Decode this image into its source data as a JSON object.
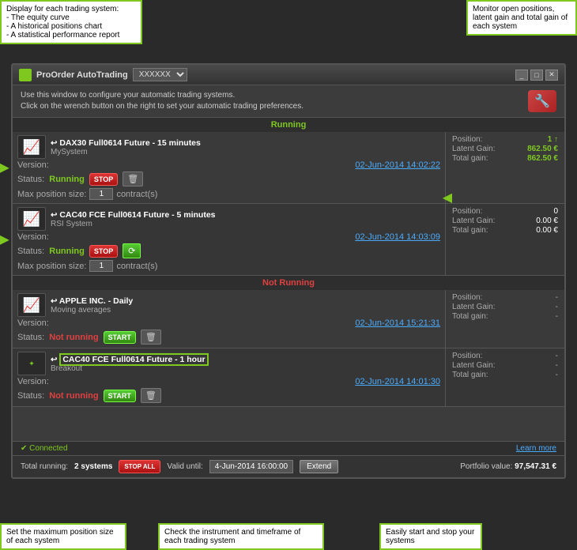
{
  "annotations": {
    "topleft": {
      "lines": [
        "Display for each trading system:",
        "- The equity curve",
        "- A historical positions chart",
        "- A statistical performance report"
      ]
    },
    "topright": {
      "text": "Monitor open positions, latent gain and total gain of each system"
    },
    "bottomleft": {
      "text": "Set the maximum position size of each system"
    },
    "bottomcenter": {
      "text": "Check the instrument and timeframe of each trading system"
    },
    "bottomright": {
      "text": "Easily start and stop your systems"
    }
  },
  "window": {
    "title": "ProOrder AutoTrading",
    "dropdown_value": "XXXXXX",
    "header_line1": "Use this window to configure your automatic trading systems.",
    "header_line2": "Click on the wrench button on the right to set your automatic trading preferences."
  },
  "sections": {
    "running_label": "Running",
    "notrunning_label": "Not Running"
  },
  "systems": [
    {
      "id": "sys1",
      "instrument": "DAX30  Full0614 Future - 15 minutes",
      "name": "MySystem",
      "version_date": "02-Jun-2014 14:02:22",
      "status": "Running",
      "is_running": true,
      "max_position": "1",
      "position": "1 ↑",
      "latent_gain": "862.50 €",
      "total_gain": "862.50 €",
      "position_color": "green",
      "gain_color": "green"
    },
    {
      "id": "sys2",
      "instrument": "CAC40 FCE Full0614 Future - 5 minutes",
      "name": "RSI System",
      "version_date": "02-Jun-2014 14:03:09",
      "status": "Running",
      "is_running": true,
      "max_position": "1",
      "position": "0",
      "latent_gain": "0.00 €",
      "total_gain": "0.00 €",
      "position_color": "white",
      "gain_color": "white"
    },
    {
      "id": "sys3",
      "instrument": "APPLE INC. - Daily",
      "name": "Moving averages",
      "version_date": "02-Jun-2014 15:21:31",
      "status": "Not running",
      "is_running": false,
      "max_position": "",
      "position": "-",
      "latent_gain": "-",
      "total_gain": "-",
      "position_color": "dash",
      "gain_color": "dash"
    },
    {
      "id": "sys4",
      "instrument": "CAC40 FCE Full0614 Future - 1 hour",
      "name": "Breakout",
      "version_date": "02-Jun-2014 14:01:30",
      "status": "Not running",
      "is_running": false,
      "max_position": "",
      "position": "-",
      "latent_gain": "-",
      "total_gain": "-",
      "position_color": "dash",
      "gain_color": "dash"
    }
  ],
  "footer": {
    "total_running_label": "Total running:",
    "total_running_count": "2 systems",
    "valid_until_label": "Valid until:",
    "valid_date": "4-Jun-2014 16:00:00",
    "extend_label": "Extend",
    "portfolio_label": "Portfolio value:",
    "portfolio_value": "97,547.31 €"
  },
  "statusbar": {
    "connected_text": "✔ Connected",
    "learn_more": "Learn more"
  },
  "labels": {
    "version": "Version:",
    "status": "Status:",
    "max_pos": "Max position size:",
    "contracts": "contract(s)",
    "position": "Position:",
    "latent_gain": "Latent Gain:",
    "total_gain": "Total gain:",
    "stop_btn": "STOP",
    "stop_btn_all": "STOP ALL",
    "start_btn": "START"
  }
}
